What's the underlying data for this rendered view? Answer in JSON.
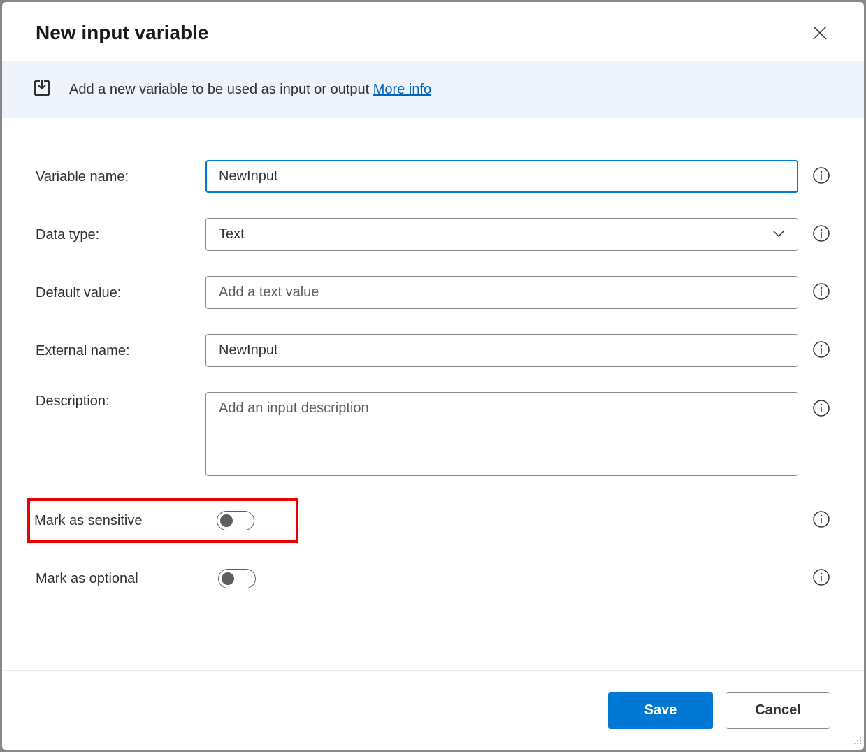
{
  "dialog": {
    "title": "New input variable"
  },
  "banner": {
    "text": "Add a new variable to be used as input or output ",
    "link": "More info"
  },
  "fields": {
    "variableName": {
      "label": "Variable name:",
      "value": "NewInput"
    },
    "dataType": {
      "label": "Data type:",
      "value": "Text"
    },
    "defaultValue": {
      "label": "Default value:",
      "placeholder": "Add a text value",
      "value": ""
    },
    "externalName": {
      "label": "External name:",
      "value": "NewInput"
    },
    "description": {
      "label": "Description:",
      "placeholder": "Add an input description",
      "value": ""
    },
    "markSensitive": {
      "label": "Mark as sensitive",
      "value": false
    },
    "markOptional": {
      "label": "Mark as optional",
      "value": false
    }
  },
  "buttons": {
    "save": "Save",
    "cancel": "Cancel"
  }
}
